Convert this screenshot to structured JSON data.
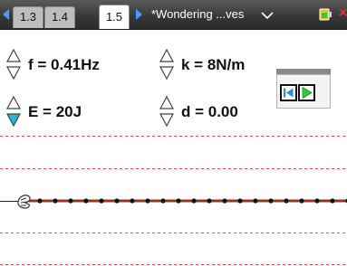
{
  "tabs": [
    {
      "label": "1.3"
    },
    {
      "label": "1.4"
    },
    {
      "label": "1.5",
      "active": true
    }
  ],
  "document": {
    "title": "*Wondering ...ves"
  },
  "controls": {
    "frequency": "f = 0.41Hz",
    "spring_constant": "k = 8N/m",
    "energy": "E = 20J",
    "damping": "d = 0.00"
  },
  "colors": {
    "accent_blue": "#3da0ff",
    "spin_active": "#29b6d6",
    "rope": "#8b3a1c",
    "guide_line": "#e05050",
    "play_green": "#2ecc40"
  },
  "icons": {
    "prev_page": "chevron-left-icon",
    "next_page": "chevron-right-icon",
    "doc_menu": "chevron-down-icon",
    "battery": "battery-icon",
    "close": "close-icon",
    "reset": "reset-icon",
    "play": "play-icon",
    "hand": "hand-icon"
  }
}
